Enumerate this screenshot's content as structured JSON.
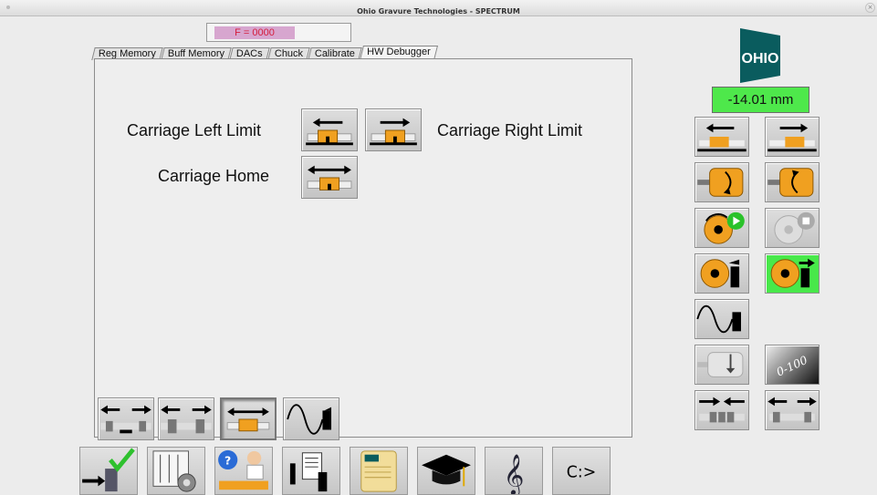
{
  "window": {
    "title": "Ohio Gravure Technologies - SPECTRUM"
  },
  "status": {
    "f_value": "F = 0000"
  },
  "tabs": [
    {
      "label": "Reg Memory"
    },
    {
      "label": "Buff Memory"
    },
    {
      "label": "DACs"
    },
    {
      "label": "Chuck"
    },
    {
      "label": "Calibrate"
    },
    {
      "label": "HW Debugger",
      "active": true
    }
  ],
  "debugger": {
    "carriage_left_label": "Carriage Left Limit",
    "carriage_right_label": "Carriage Right Limit",
    "carriage_home_label": "Carriage Home"
  },
  "logo": {
    "text": "OHIO",
    "color": "#0a5c5e"
  },
  "position_readout": "-14.01 mm",
  "right_panel": {
    "scale_label": "0-100"
  },
  "dock": {
    "terminal_label": "C:>"
  },
  "colors": {
    "accent_green": "#48e84a",
    "orange": "#f0a020",
    "teal": "#0a5c5e",
    "fbox_text": "#d41c3c"
  }
}
